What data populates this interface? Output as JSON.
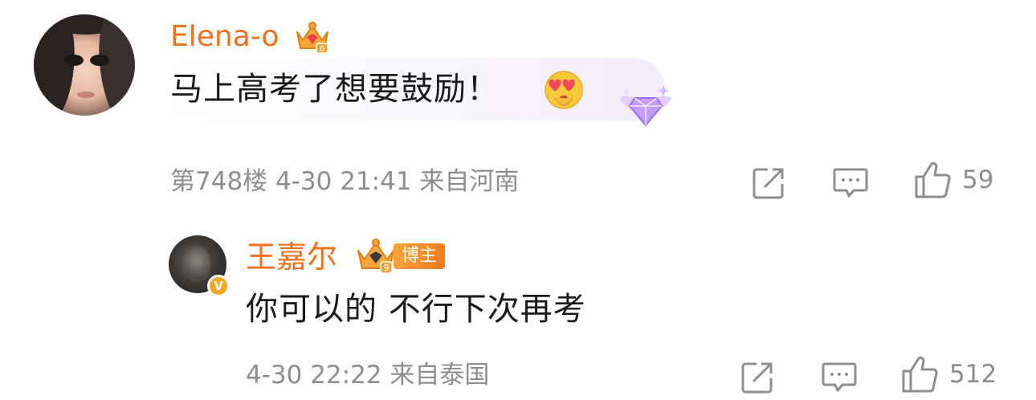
{
  "comment": {
    "username": "Elena-o",
    "level_badge": "6",
    "text": "马上高考了想要鼓励！",
    "emoji": "heart-eyes-emoji",
    "meta": "第748楼  4-30  21:41  来自河南",
    "likes": "59"
  },
  "reply": {
    "username": "王嘉尔",
    "level_badge": "9",
    "role_badge": "博主",
    "verified_badge": "V",
    "text": "你可以的 不行下次再考",
    "meta": "4-30  22:22  来自泰国",
    "likes": "512"
  },
  "icons": {
    "share": "share-icon",
    "reply": "comment-icon",
    "like": "thumbs-up-icon"
  },
  "colors": {
    "username": "#f0701f",
    "meta": "#8e8e8e",
    "text": "#1a1a1a",
    "verified": "#f6a623"
  }
}
